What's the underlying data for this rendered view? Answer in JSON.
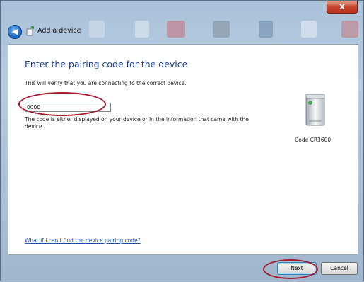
{
  "window": {
    "title": "Add a device",
    "close_glyph": "x",
    "back_glyph": "◀"
  },
  "main": {
    "heading": "Enter the pairing code for the device",
    "description": "This will verify that you are connecting to the correct device.",
    "code_input": {
      "value": "0000",
      "placeholder": ""
    },
    "help_text": "The code is either displayed on your device or in the information that came with the device.",
    "device": {
      "label": "Code CR3600",
      "icon": "printer-device-icon"
    },
    "help_link": "What if I can't find the device pairing code?"
  },
  "footer": {
    "next_label": "Next",
    "cancel_label": "Cancel"
  },
  "annotation_color": "#a3182b"
}
